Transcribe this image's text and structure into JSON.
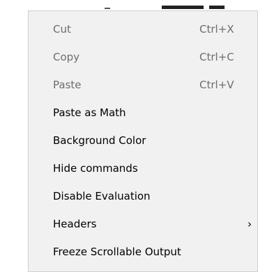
{
  "context_menu": {
    "items": [
      {
        "label": "Cut",
        "shortcut": "Ctrl+X",
        "enabled": false
      },
      {
        "label": "Copy",
        "shortcut": "Ctrl+C",
        "enabled": false
      },
      {
        "label": "Paste",
        "shortcut": "Ctrl+V",
        "enabled": false
      },
      {
        "label": "Paste as Math",
        "shortcut": "",
        "enabled": true
      },
      {
        "label": "Background Color",
        "shortcut": "",
        "enabled": true
      },
      {
        "label": "Hide commands",
        "shortcut": "",
        "enabled": true
      },
      {
        "label": "Disable Evaluation",
        "shortcut": "",
        "enabled": true
      },
      {
        "label": "Headers",
        "shortcut": "",
        "enabled": true,
        "submenu_icon": "chevron-right-icon",
        "submenu_glyph": "›"
      },
      {
        "label": "Freeze Scrollable Output",
        "shortcut": "",
        "enabled": true
      }
    ]
  },
  "colors": {
    "menu_background": "#f1f1f1",
    "enabled_text": "#000000",
    "disabled_text": "#6d6d6d"
  }
}
